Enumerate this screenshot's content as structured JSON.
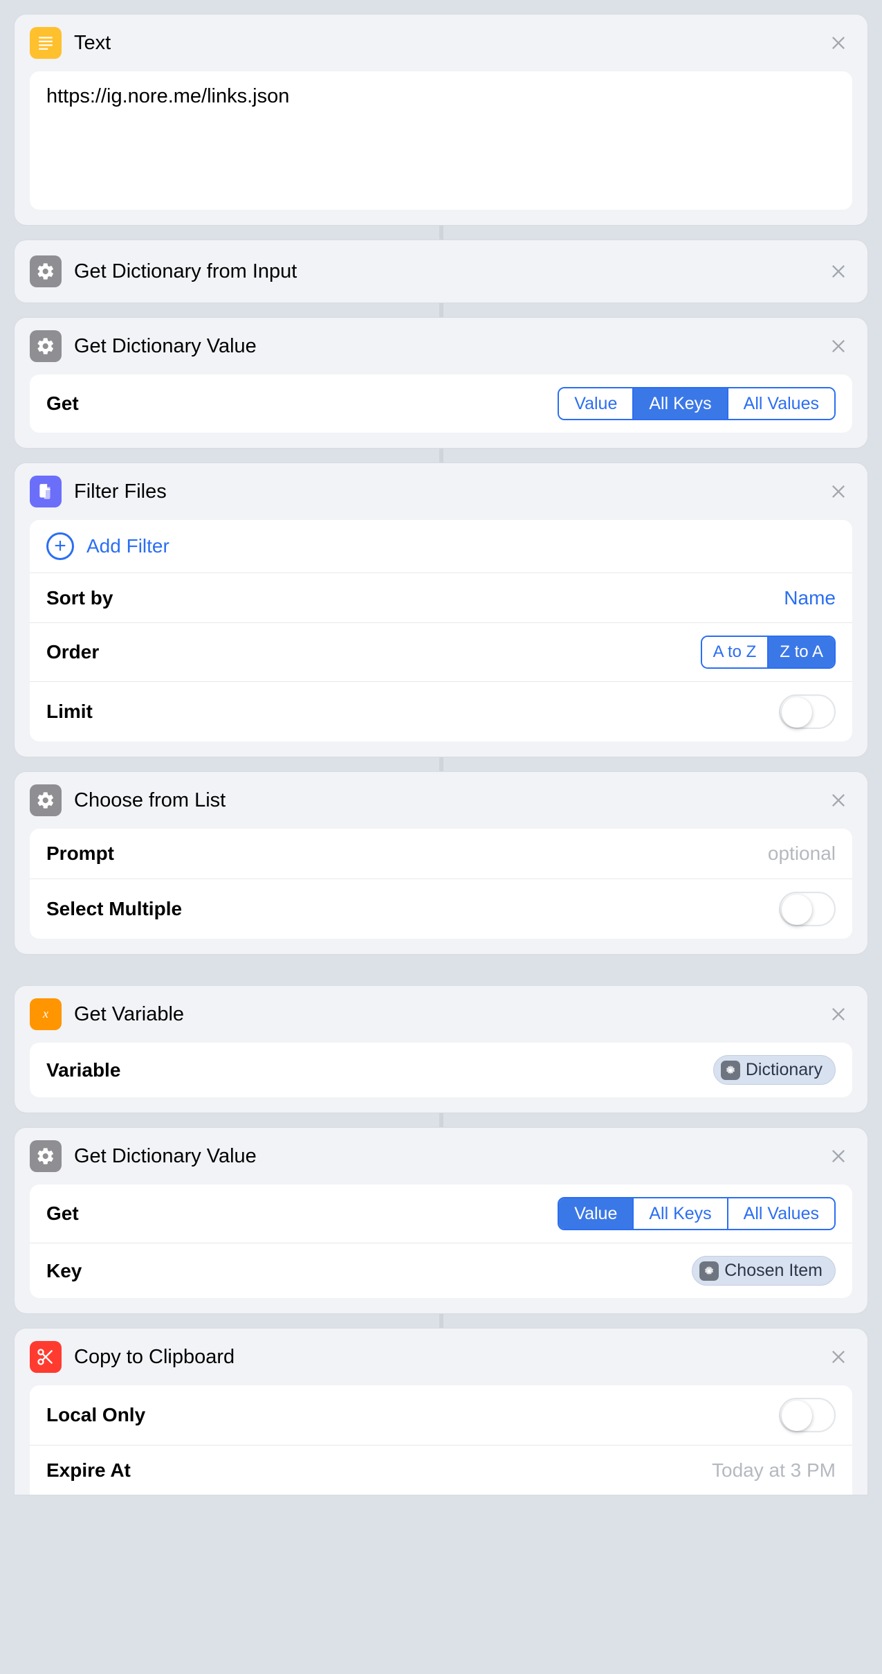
{
  "actions": [
    {
      "id": "text",
      "title": "Text",
      "icon": "text",
      "textarea_value": "https://ig.nore.me/links.json"
    },
    {
      "id": "get_dict_from_input",
      "title": "Get Dictionary from Input",
      "icon": "gear"
    },
    {
      "id": "get_dict_value_1",
      "title": "Get Dictionary Value",
      "icon": "gear",
      "rows": {
        "get_label": "Get",
        "get_options": [
          "Value",
          "All Keys",
          "All Values"
        ],
        "get_selected": "All Keys"
      }
    },
    {
      "id": "filter_files",
      "title": "Filter Files",
      "icon": "files",
      "add_filter_label": "Add Filter",
      "sort_by_label": "Sort by",
      "sort_by_value": "Name",
      "order_label": "Order",
      "order_options": [
        "A to Z",
        "Z to A"
      ],
      "order_selected": "Z to A",
      "limit_label": "Limit",
      "limit_on": false
    },
    {
      "id": "choose_from_list",
      "title": "Choose from List",
      "icon": "gear",
      "prompt_label": "Prompt",
      "prompt_placeholder": "optional",
      "select_multiple_label": "Select Multiple",
      "select_multiple_on": false
    },
    {
      "id": "get_variable",
      "title": "Get Variable",
      "icon": "var",
      "variable_label": "Variable",
      "variable_pill": "Dictionary"
    },
    {
      "id": "get_dict_value_2",
      "title": "Get Dictionary Value",
      "icon": "gear",
      "get_label": "Get",
      "get_options": [
        "Value",
        "All Keys",
        "All Values"
      ],
      "get_selected": "Value",
      "key_label": "Key",
      "key_pill": "Chosen Item"
    },
    {
      "id": "copy_clipboard",
      "title": "Copy to Clipboard",
      "icon": "clip",
      "local_only_label": "Local Only",
      "local_only_on": false,
      "expire_label": "Expire At",
      "expire_placeholder": "Today at 3 PM"
    }
  ]
}
